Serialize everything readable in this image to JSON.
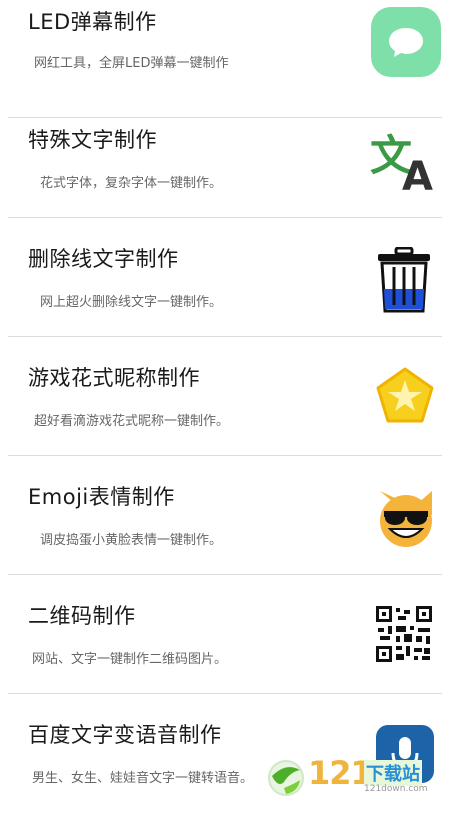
{
  "items": [
    {
      "title": "LED弹幕制作",
      "subtitle": "网红工具，全屏LED弹幕一键制作",
      "icon": "chat-bubble-icon"
    },
    {
      "title": "特殊文字制作",
      "subtitle": "花式字体，复杂字体一键制作。",
      "icon": "translate-icon"
    },
    {
      "title": "删除线文字制作",
      "subtitle": "网上超火删除线文字一键制作。",
      "icon": "trash-can-icon"
    },
    {
      "title": "游戏花式昵称制作",
      "subtitle": "超好看滴游戏花式昵称一键制作。",
      "icon": "star-badge-icon"
    },
    {
      "title": "Emoji表情制作",
      "subtitle": "调皮捣蛋小黄脸表情一键制作。",
      "icon": "cool-cat-emoji-icon"
    },
    {
      "title": "二维码制作",
      "subtitle": "网站、文字一键制作二维码图片。",
      "icon": "qr-code-icon"
    },
    {
      "title": "百度文字变语音制作",
      "subtitle": "男生、女生、娃娃音文字一键转语音。",
      "icon": "microphone-icon"
    }
  ],
  "watermark": {
    "number": "121",
    "text": "下载站",
    "url": "121down.com"
  },
  "colors": {
    "bubble": "#7ee0a8",
    "translate_green": "#3a9a45",
    "trash_blue": "#1f4fd8",
    "star_yellow": "#f7cf1d",
    "mic_blue": "#1c63a8"
  }
}
